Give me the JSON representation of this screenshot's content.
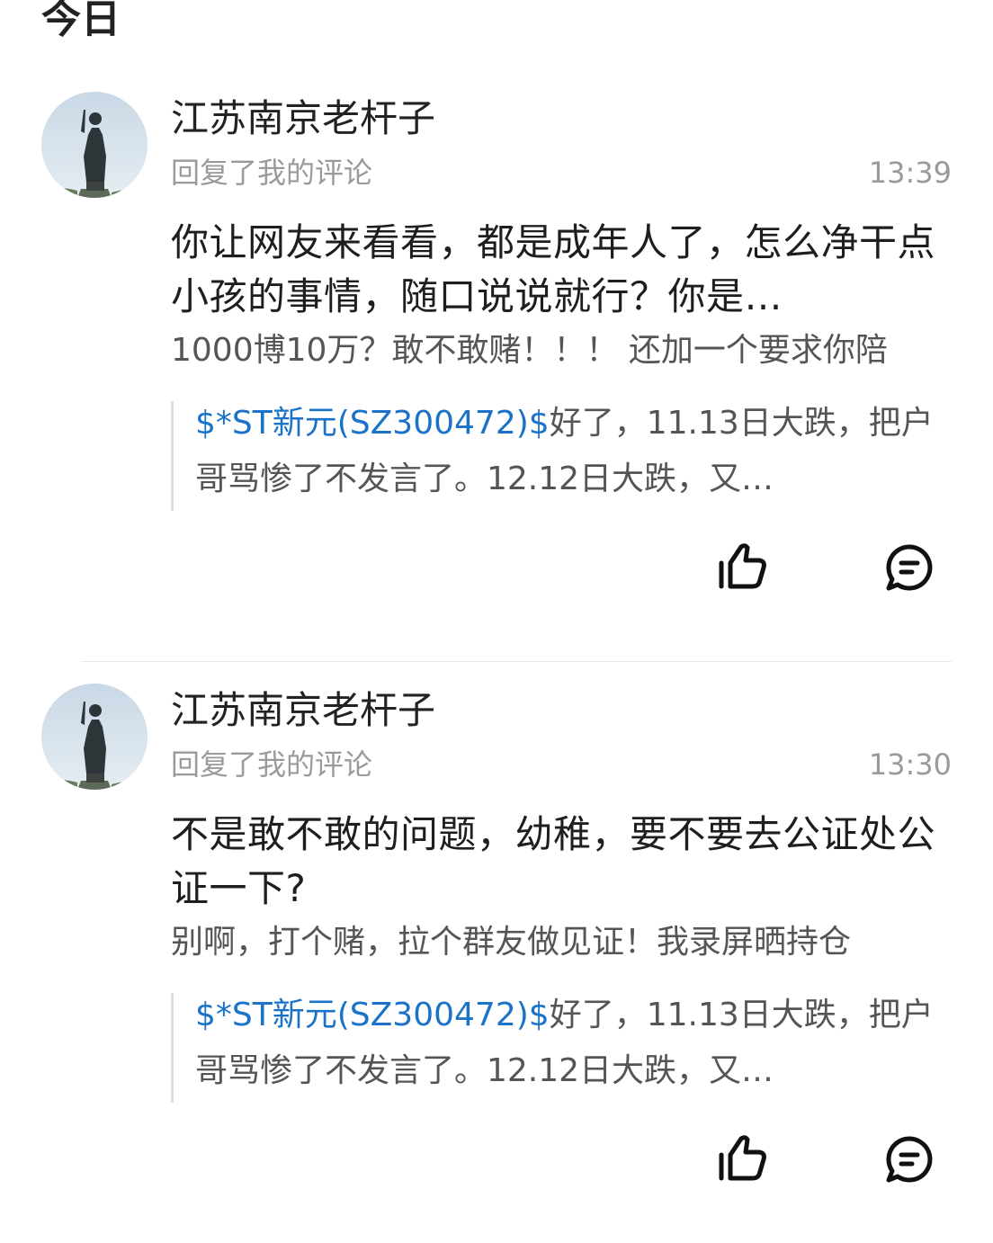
{
  "section": {
    "title": "今日"
  },
  "notifications": [
    {
      "username": "江苏南京老杆子",
      "action": "回复了我的评论",
      "time": "13:39",
      "reply": "你让网友来看看，都是成年人了，怎么净干点小孩的事情，随口说说就行？你是…",
      "my_comment": "1000博10万？敢不敢赌！！！ 还加一个要求你陪",
      "quote_stock": "$*ST新元(SZ300472)$",
      "quote_text": "好了，11.13日大跌，把户哥骂惨了不发言了。12.12日大跌，又…"
    },
    {
      "username": "江苏南京老杆子",
      "action": "回复了我的评论",
      "time": "13:30",
      "reply": "不是敢不敢的问题，幼稚，要不要去公证处公证一下?",
      "my_comment": "别啊，打个赌，拉个群友做见证！我录屏晒持仓",
      "quote_stock": "$*ST新元(SZ300472)$",
      "quote_text": "好了，11.13日大跌，把户哥骂惨了不发言了。12.12日大跌，又…"
    }
  ],
  "icons": {
    "like": "thumbs-up-icon",
    "comment": "comment-bubble-icon"
  },
  "colors": {
    "stock_link": "#1a73c8",
    "secondary_text": "#9a9a9a",
    "icon": "#111111"
  }
}
